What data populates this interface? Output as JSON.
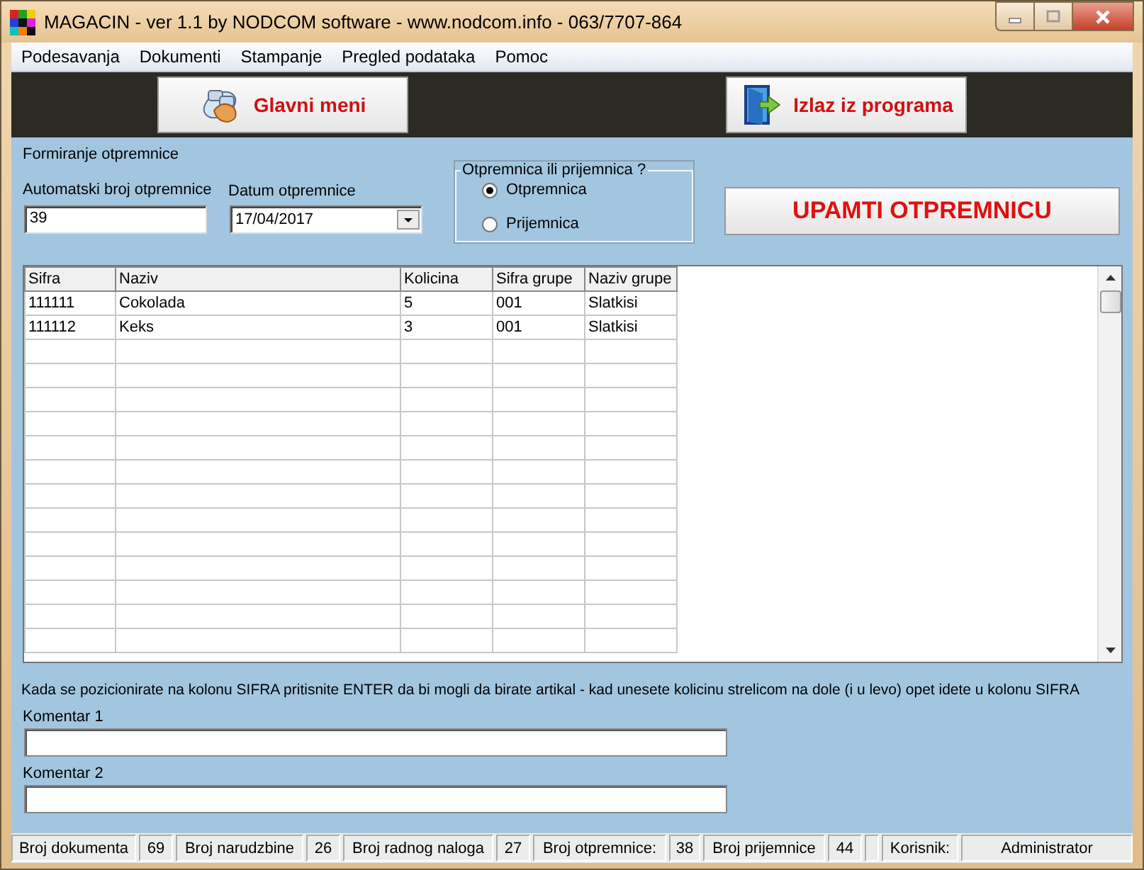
{
  "window": {
    "title": "MAGACIN - ver 1.1 by NODCOM software - www.nodcom.info - 063/7707-864"
  },
  "menu": [
    "Podesavanja",
    "Dokumenti",
    "Stampanje",
    "Pregled podataka",
    "Pomoc"
  ],
  "toolbar": [
    {
      "label": "Glavni meni",
      "kind": "hand"
    },
    {
      "label": "Izlaz iz programa",
      "kind": "door"
    }
  ],
  "form": {
    "heading": "Formiranje otpremnice",
    "number": {
      "label": "Automatski broj otpremnice",
      "value": "39"
    },
    "date": {
      "label": "Datum otpremnice",
      "value": "17/04/2017"
    },
    "type_group": {
      "title": "Otpremnica ili prijemnica ?",
      "options": [
        {
          "label": "Otpremnica",
          "selected": true
        },
        {
          "label": "Prijemnica",
          "selected": false
        }
      ]
    },
    "save_button": "UPAMTI OTPREMNICU"
  },
  "table": {
    "columns": [
      "Sifra",
      "Naziv",
      "Kolicina",
      "Sifra grupe",
      "Naziv grupe"
    ],
    "rows": [
      [
        "111111",
        "Cokolada",
        "5",
        "001",
        "Slatkisi"
      ],
      [
        "111112",
        "Keks",
        "3",
        "001",
        "Slatkisi"
      ]
    ]
  },
  "hint": "Kada se pozicionirate na kolonu SIFRA pritisnite ENTER da bi mogli da birate artikal - kad unesete kolicinu strelicom na dole (i u levo) opet idete u kolonu SIFRA",
  "comments": [
    {
      "label": "Komentar 1"
    },
    {
      "label": "Komentar 2"
    }
  ],
  "status_bar": [
    {
      "label": "Broj dokumenta",
      "value": "69"
    },
    {
      "label": "Broj narudzbine",
      "value": "26"
    },
    {
      "label": "Broj radnog naloga",
      "value": "27"
    },
    {
      "label": "Broj otpremnice:",
      "value": "38"
    },
    {
      "label": "Broj prijemnice",
      "value": "44"
    },
    {
      "label": "Korisnik:",
      "value": "Administrator"
    }
  ]
}
